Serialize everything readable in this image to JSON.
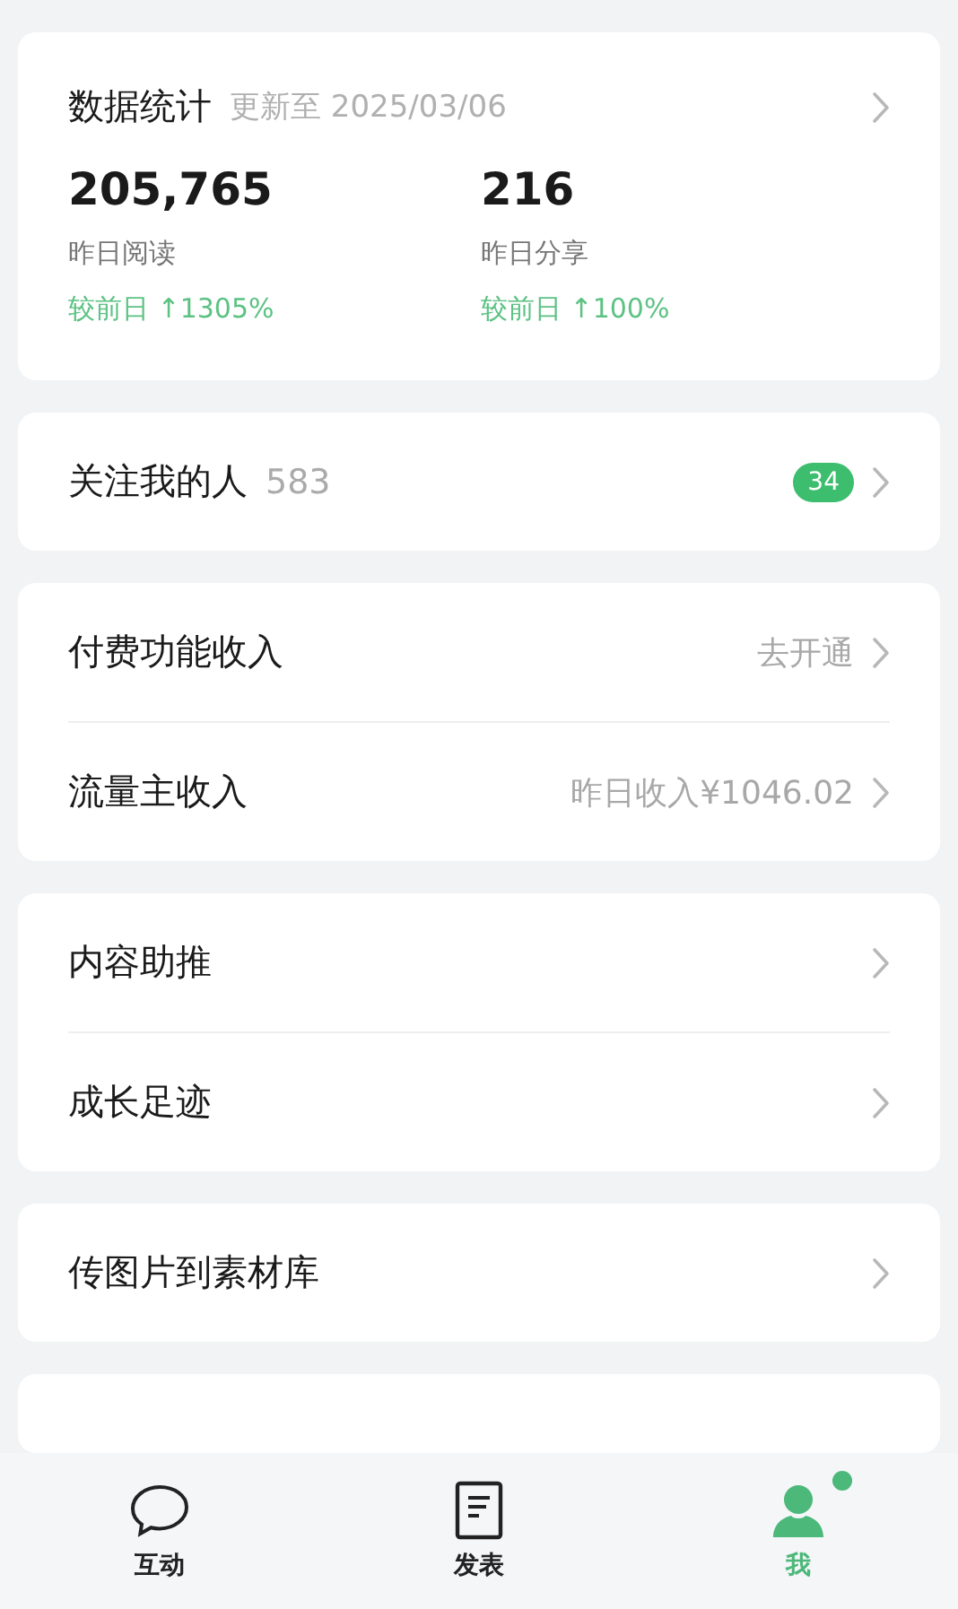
{
  "stats": {
    "title": "数据统计",
    "updated": "更新至 2025/03/06",
    "metrics": [
      {
        "value": "205,765",
        "label": "昨日阅读",
        "change": "较前日 ↑1305%"
      },
      {
        "value": "216",
        "label": "昨日分享",
        "change": "较前日 ↑100%"
      }
    ]
  },
  "sections": [
    [
      {
        "label": "关注我的人",
        "count": "583",
        "badge": "34"
      }
    ],
    [
      {
        "label": "付费功能收入",
        "detail": "去开通"
      },
      {
        "label": "流量主收入",
        "detail": "昨日收入¥1046.02"
      }
    ],
    [
      {
        "label": "内容助推"
      },
      {
        "label": "成长足迹"
      }
    ],
    [
      {
        "label": "传图片到素材库"
      }
    ]
  ],
  "tabs": [
    {
      "label": "互动",
      "kind": "chat",
      "selected": false,
      "dot": false
    },
    {
      "label": "发表",
      "kind": "document",
      "selected": false,
      "dot": false
    },
    {
      "label": "我",
      "kind": "person",
      "selected": true,
      "dot": true
    }
  ]
}
